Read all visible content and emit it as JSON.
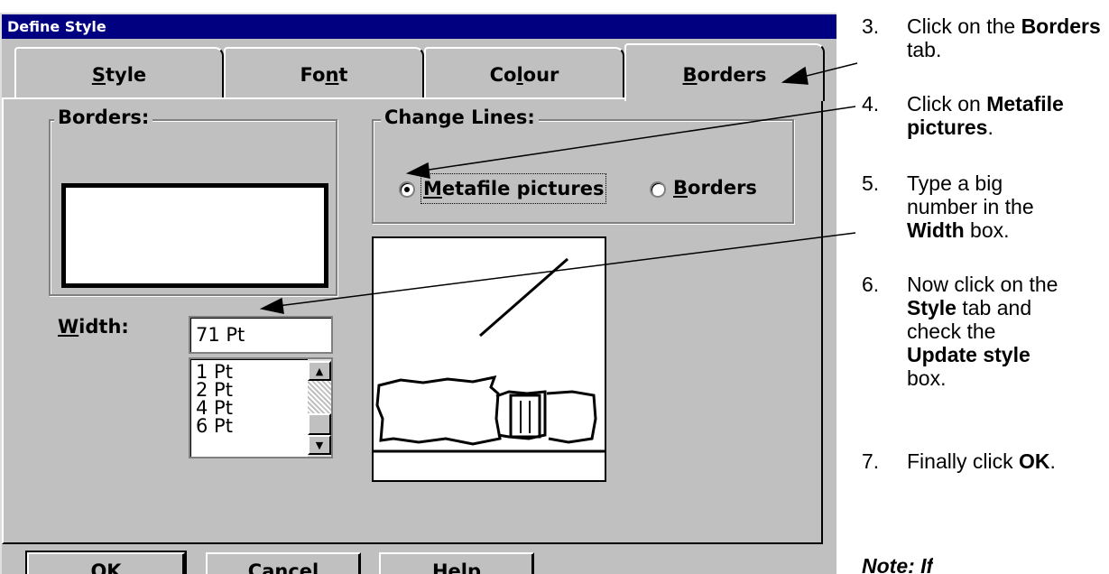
{
  "dialog": {
    "title": "Define Style",
    "tabs": [
      {
        "pre": "",
        "key": "S",
        "post": "tyle"
      },
      {
        "pre": "Fo",
        "key": "n",
        "post": "t"
      },
      {
        "pre": "Co",
        "key": "l",
        "post": "our"
      },
      {
        "pre": "",
        "key": "B",
        "post": "orders"
      }
    ],
    "active_tab": "Borders",
    "borders_group": {
      "label": "Borders:"
    },
    "change_lines": {
      "label": "Change Lines:",
      "options": [
        {
          "pre": "",
          "key": "M",
          "post": "etafile pictures",
          "selected": true
        },
        {
          "pre": "",
          "key": "B",
          "post": "orders",
          "selected": false
        }
      ]
    },
    "width": {
      "label_key": "W",
      "label_rest": "idth:",
      "value": "71 Pt",
      "options": [
        "1 Pt",
        "2 Pt",
        "4 Pt",
        "6 Pt"
      ]
    },
    "buttons": {
      "ok": "OK",
      "cancel": "Cancel",
      "help_key": "H",
      "help_rest": "elp"
    }
  },
  "instructions": [
    {
      "num": "3.",
      "parts": [
        {
          "t": "Click on the "
        },
        {
          "t": "Borders",
          "b": true
        },
        {
          "t": " tab."
        }
      ]
    },
    {
      "num": "4.",
      "parts": [
        {
          "t": "Click on "
        },
        {
          "t": "Metafile pictures",
          "b": true
        },
        {
          "t": "."
        }
      ]
    },
    {
      "num": "5.",
      "parts": [
        {
          "t": "Type a big number in the "
        },
        {
          "t": "Width",
          "b": true
        },
        {
          "t": " box."
        }
      ]
    },
    {
      "num": "6.",
      "parts": [
        {
          "t": "Now click on the "
        },
        {
          "t": "Style",
          "b": true
        },
        {
          "t": " tab and check the "
        },
        {
          "t": "Update style",
          "b": true
        },
        {
          "t": " box."
        }
      ]
    },
    {
      "num": "7.",
      "parts": [
        {
          "t": "Finally click "
        },
        {
          "t": "OK",
          "b": true
        },
        {
          "t": "."
        }
      ]
    }
  ],
  "footer_note": "Note: If"
}
